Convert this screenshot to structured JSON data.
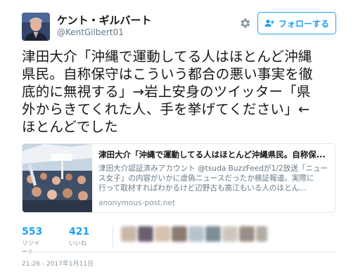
{
  "user": {
    "name": "ケント・ギルバート",
    "handle": "@KentGilbert01"
  },
  "follow_button": {
    "label": "フォローする"
  },
  "tweet": {
    "lines": [
      "津田大介「沖縄で運動してる人はほとんど沖縄",
      "県民。自称保守はこういう都合の悪い事実を徹",
      "底的に無視する」→岩上安身のツイッター「県",
      "外からきてくれた人、手を挙げてください」←",
      "ほとんどでした"
    ]
  },
  "card": {
    "title": "津田大介「沖縄で運動してる人はほとんど沖縄県民。自称保...",
    "description": [
      "津田大介認証済みアカウント @tsuda BuzzFeedが1/2放送「ニュー",
      "ス女子」の内容がいかに虚偽ニュースだったか検証報道。実際に",
      "行って取材すればわかるけど辺野古も高江もいる人のほとん..."
    ],
    "domain": "anonymous-post.net"
  },
  "stats": {
    "retweets": {
      "count": "553",
      "label": "リツイート"
    },
    "likes": {
      "count": "421",
      "label": "いいね"
    }
  },
  "timestamp": "21:26 - 2017年1月11日",
  "colors": {
    "accent": "#1da1f2",
    "secondary_text": "#657786"
  }
}
